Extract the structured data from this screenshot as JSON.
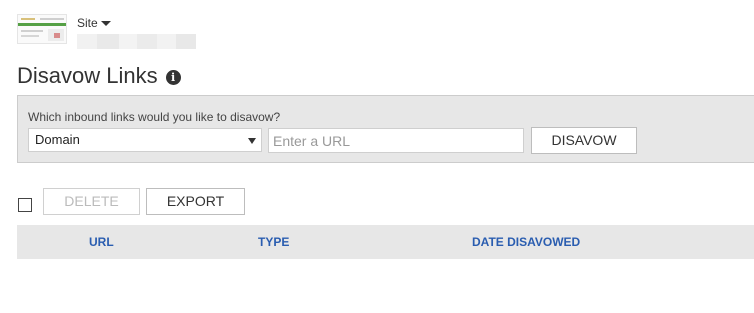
{
  "site": {
    "label": "Site",
    "url_redacted": true
  },
  "page": {
    "title": "Disavow Links"
  },
  "disavow_panel": {
    "question": "Which inbound links would you like to disavow?",
    "type_selected": "Domain",
    "url_placeholder": "Enter a URL",
    "url_value": "",
    "submit_label": "DISAVOW"
  },
  "toolbar": {
    "delete_label": "DELETE",
    "delete_disabled": true,
    "export_label": "EXPORT"
  },
  "table": {
    "columns": [
      "URL",
      "TYPE",
      "DATE DISAVOWED"
    ],
    "rows": []
  },
  "colors": {
    "panel_bg": "#e7e7e7",
    "header_link": "#2a5db0",
    "thumb_accent": "#55a045"
  },
  "icons": {
    "info": "info-circle-icon",
    "site_caret": "caret-down-icon",
    "select_arrow": "select-arrow-icon"
  }
}
